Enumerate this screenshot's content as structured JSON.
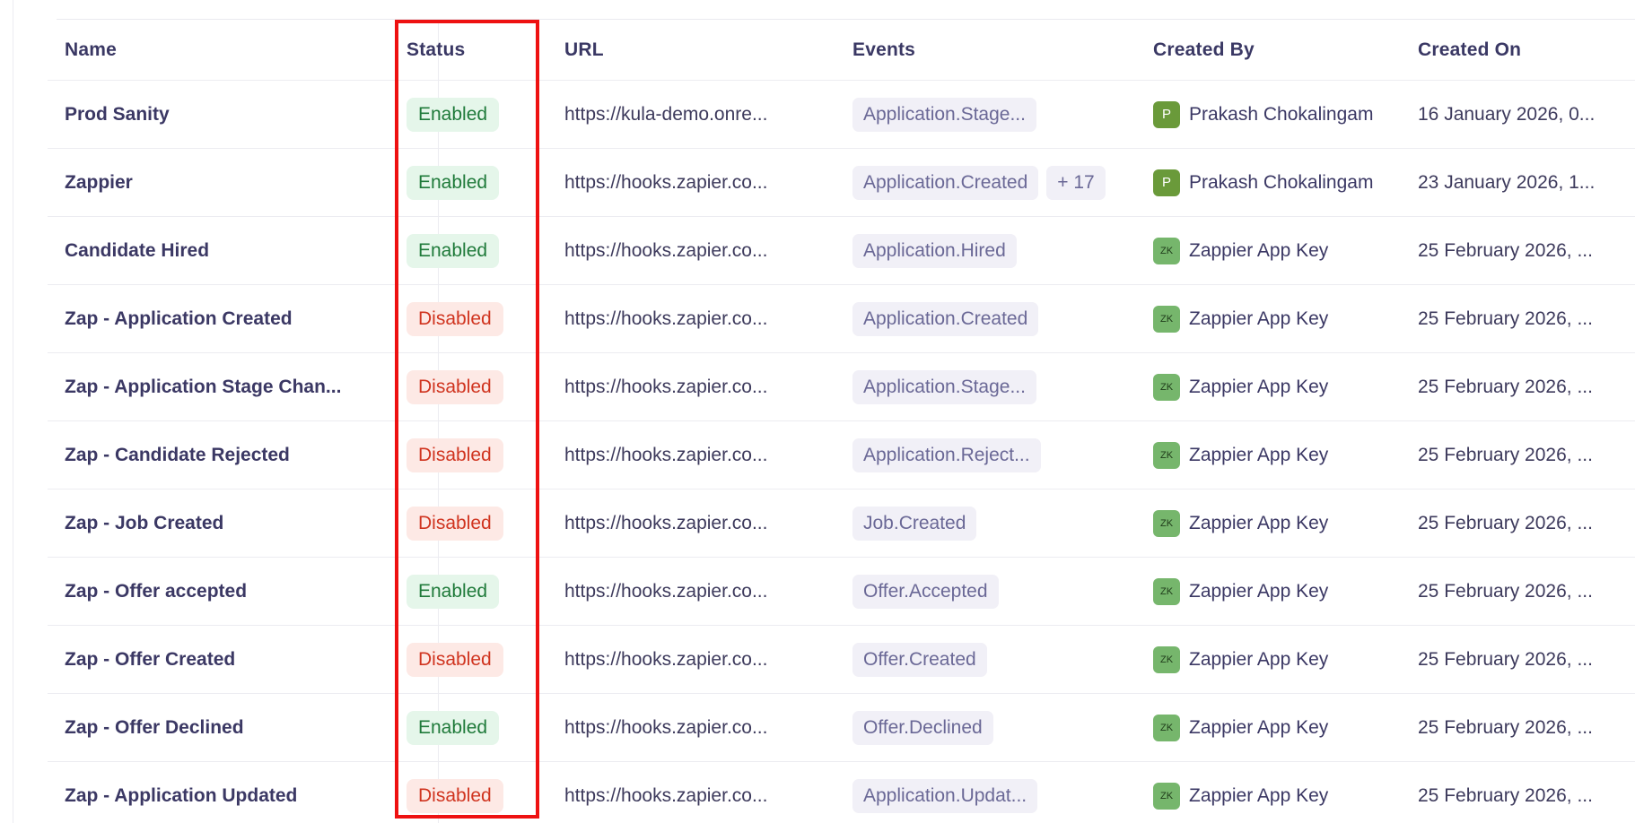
{
  "columns": {
    "name": "Name",
    "status": "Status",
    "url": "URL",
    "events": "Events",
    "created_by": "Created By",
    "created_on": "Created On"
  },
  "rows": [
    {
      "name": "Prod Sanity",
      "status": "Enabled",
      "url": "https://kula-demo.onre...",
      "events": [
        "Application.Stage..."
      ],
      "extra": "",
      "avatar": "P",
      "created_by": "Prakash Chokalingam",
      "created_on": "16 January 2026, 0..."
    },
    {
      "name": "Zappier",
      "status": "Enabled",
      "url": "https://hooks.zapier.co...",
      "events": [
        "Application.Created"
      ],
      "extra": "+ 17",
      "avatar": "P",
      "created_by": "Prakash Chokalingam",
      "created_on": "23 January 2026, 1..."
    },
    {
      "name": "Candidate Hired",
      "status": "Enabled",
      "url": "https://hooks.zapier.co...",
      "events": [
        "Application.Hired"
      ],
      "extra": "",
      "avatar": "ZK",
      "created_by": "Zappier App Key",
      "created_on": "25 February 2026, ..."
    },
    {
      "name": "Zap - Application Created",
      "status": "Disabled",
      "url": "https://hooks.zapier.co...",
      "events": [
        "Application.Created"
      ],
      "extra": "",
      "avatar": "ZK",
      "created_by": "Zappier App Key",
      "created_on": "25 February 2026, ..."
    },
    {
      "name": "Zap - Application Stage Chan...",
      "status": "Disabled",
      "url": "https://hooks.zapier.co...",
      "events": [
        "Application.Stage..."
      ],
      "extra": "",
      "avatar": "ZK",
      "created_by": "Zappier App Key",
      "created_on": "25 February 2026, ..."
    },
    {
      "name": "Zap - Candidate Rejected",
      "status": "Disabled",
      "url": "https://hooks.zapier.co...",
      "events": [
        "Application.Reject..."
      ],
      "extra": "",
      "avatar": "ZK",
      "created_by": "Zappier App Key",
      "created_on": "25 February 2026, ..."
    },
    {
      "name": "Zap - Job Created",
      "status": "Disabled",
      "url": "https://hooks.zapier.co...",
      "events": [
        "Job.Created"
      ],
      "extra": "",
      "avatar": "ZK",
      "created_by": "Zappier App Key",
      "created_on": "25 February 2026, ..."
    },
    {
      "name": "Zap - Offer accepted",
      "status": "Enabled",
      "url": "https://hooks.zapier.co...",
      "events": [
        "Offer.Accepted"
      ],
      "extra": "",
      "avatar": "ZK",
      "created_by": "Zappier App Key",
      "created_on": "25 February 2026, ..."
    },
    {
      "name": "Zap - Offer Created",
      "status": "Disabled",
      "url": "https://hooks.zapier.co...",
      "events": [
        "Offer.Created"
      ],
      "extra": "",
      "avatar": "ZK",
      "created_by": "Zappier App Key",
      "created_on": "25 February 2026, ..."
    },
    {
      "name": "Zap - Offer Declined",
      "status": "Enabled",
      "url": "https://hooks.zapier.co...",
      "events": [
        "Offer.Declined"
      ],
      "extra": "",
      "avatar": "ZK",
      "created_by": "Zappier App Key",
      "created_on": "25 February 2026, ..."
    },
    {
      "name": "Zap - Application Updated",
      "status": "Disabled",
      "url": "https://hooks.zapier.co...",
      "events": [
        "Application.Updat..."
      ],
      "extra": "",
      "avatar": "ZK",
      "created_by": "Zappier App Key",
      "created_on": "25 February 2026, ..."
    }
  ],
  "colors": {
    "enabled_bg": "#e5f6ea",
    "enabled_text": "#1f7a3a",
    "disabled_bg": "#fde9e5",
    "disabled_text": "#d0341f",
    "highlight": "#ee1111"
  }
}
